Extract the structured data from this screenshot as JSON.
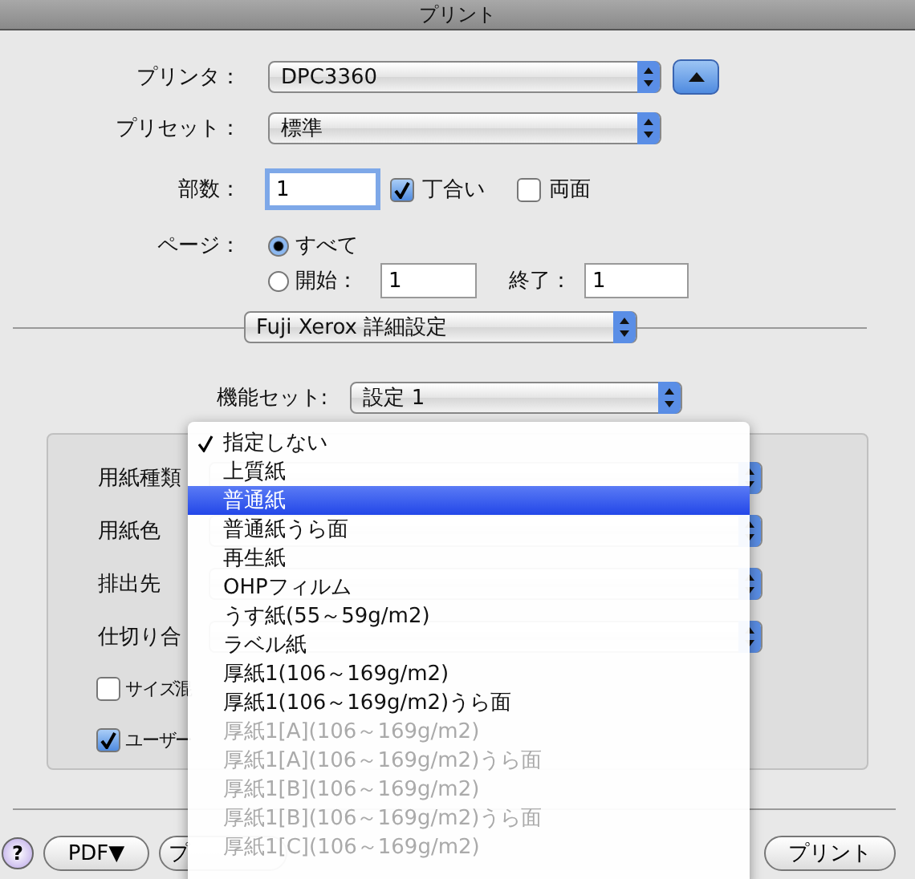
{
  "window": {
    "title": "プリント"
  },
  "printer": {
    "label": "プリンタ：",
    "value": "DPC3360"
  },
  "preset": {
    "label": "プリセット：",
    "value": "標準"
  },
  "copies": {
    "label": "部数：",
    "value": "1",
    "collate": {
      "label": "丁合い",
      "checked": true
    },
    "duplex": {
      "label": "両面",
      "checked": false
    }
  },
  "pages": {
    "label": "ページ：",
    "options": [
      {
        "label": "すべて",
        "selected": true
      },
      {
        "label": "開始：",
        "selected": false
      }
    ],
    "from": "1",
    "to_label": "終了：",
    "to": "1"
  },
  "panel_menu": {
    "value": "Fuji Xerox 詳細設定"
  },
  "feature_set": {
    "label": "機能セット:",
    "value": "設定 1"
  },
  "settings": [
    {
      "kind": "popup",
      "label": "用紙種類"
    },
    {
      "kind": "popup",
      "label": "用紙色"
    },
    {
      "kind": "popup",
      "label": "排出先"
    },
    {
      "kind": "popup",
      "label": "仕切り合"
    },
    {
      "kind": "checkbox",
      "label": "サイズ混",
      "checked": false
    },
    {
      "kind": "checkbox",
      "label": "ユーザー",
      "checked": true
    }
  ],
  "buttons": {
    "help": "?",
    "pdf": "PDF▼",
    "preview": "プ",
    "print": "プリント"
  },
  "dropdown": [
    {
      "label": "指定しない",
      "checked": true,
      "selected": false,
      "disabled": false
    },
    {
      "label": "上質紙",
      "checked": false,
      "selected": false,
      "disabled": false
    },
    {
      "label": "普通紙",
      "checked": false,
      "selected": true,
      "disabled": false
    },
    {
      "label": "普通紙うら面",
      "checked": false,
      "selected": false,
      "disabled": false
    },
    {
      "label": "再生紙",
      "checked": false,
      "selected": false,
      "disabled": false
    },
    {
      "label": "OHPフィルム",
      "checked": false,
      "selected": false,
      "disabled": false
    },
    {
      "label": "うす紙(55～59g/m2)",
      "checked": false,
      "selected": false,
      "disabled": false
    },
    {
      "label": "ラベル紙",
      "checked": false,
      "selected": false,
      "disabled": false
    },
    {
      "label": "厚紙1(106～169g/m2)",
      "checked": false,
      "selected": false,
      "disabled": false
    },
    {
      "label": "厚紙1(106～169g/m2)うら面",
      "checked": false,
      "selected": false,
      "disabled": false
    },
    {
      "label": "厚紙1[A](106～169g/m2)",
      "checked": false,
      "selected": false,
      "disabled": true
    },
    {
      "label": "厚紙1[A](106～169g/m2)うら面",
      "checked": false,
      "selected": false,
      "disabled": true
    },
    {
      "label": "厚紙1[B](106～169g/m2)",
      "checked": false,
      "selected": false,
      "disabled": true
    },
    {
      "label": "厚紙1[B](106～169g/m2)うら面",
      "checked": false,
      "selected": false,
      "disabled": true
    },
    {
      "label": "厚紙1[C](106～169g/m2)",
      "checked": false,
      "selected": false,
      "disabled": true
    }
  ]
}
